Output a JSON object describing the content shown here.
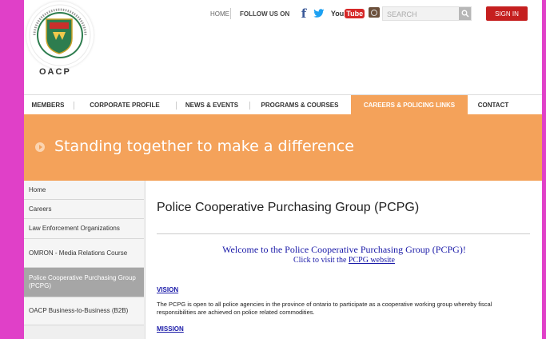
{
  "top_bar": {
    "home_label": "HOME",
    "follow_label": "FOLLOW US ON",
    "social_icons": [
      "facebook-icon",
      "twitter-icon",
      "youtube-icon",
      "instagram-icon"
    ],
    "youtube_you": "You",
    "youtube_tube": "Tube",
    "search_placeholder": "SEARCH",
    "signin_label": "SIGN IN"
  },
  "logo": {
    "text": "OACP"
  },
  "nav": {
    "items": [
      {
        "label": "MEMBERS"
      },
      {
        "label": "CORPORATE PROFILE"
      },
      {
        "label": "NEWS & EVENTS"
      },
      {
        "label": "PROGRAMS & COURSES"
      },
      {
        "label": "CAREERS & POLICING LINKS",
        "active": true
      },
      {
        "label": "CONTACT"
      }
    ]
  },
  "banner": {
    "text": "Standing together to make a difference"
  },
  "sidebar": {
    "items": [
      {
        "label": "Home"
      },
      {
        "label": "Careers"
      },
      {
        "label": "Law Enforcement Organizations"
      },
      {
        "label": "OMRON - Media Relations Course"
      },
      {
        "label": "Police Cooperative Purchasing Group (PCPG)",
        "active": true
      },
      {
        "label": "OACP Business-to-Business (B2B)"
      }
    ]
  },
  "content": {
    "title": "Police Cooperative Purchasing Group (PCPG)",
    "welcome_line1": "Welcome to the Police Cooperative Purchasing Group (PCPG)!",
    "welcome_line2_prefix": "Click to visit the ",
    "welcome_link": "PCPG website",
    "vision_heading": "VISION",
    "vision_text": "The PCPG is open to all police agencies in the province of ontario to participate as a cooperative working group whereby fiscal responsibilities are achieved on police related commodities.",
    "mission_heading": "MISSION"
  },
  "colors": {
    "background": "#e040c8",
    "accent_orange": "#f4a25a",
    "signin_red": "#c51f1f",
    "link_blue": "#1a1aa8"
  }
}
